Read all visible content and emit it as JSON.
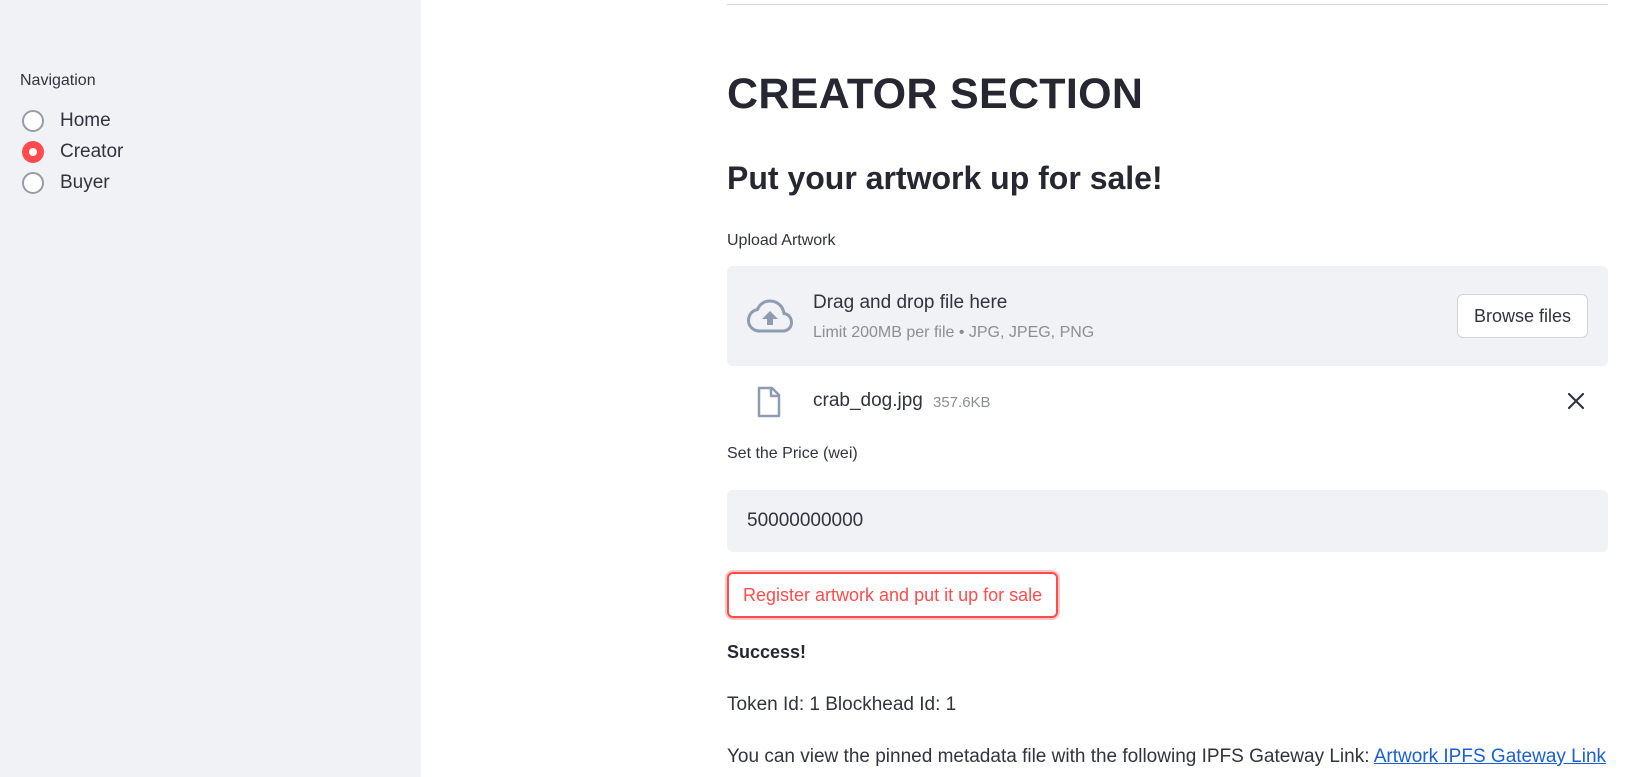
{
  "sidebar": {
    "label": "Navigation",
    "options": [
      {
        "label": "Home",
        "selected": false
      },
      {
        "label": "Creator",
        "selected": true
      },
      {
        "label": "Buyer",
        "selected": false
      }
    ]
  },
  "main": {
    "title": "CREATOR SECTION",
    "subtitle": "Put your artwork up for sale!",
    "upload": {
      "label": "Upload Artwork",
      "dropzone_title": "Drag and drop file here",
      "limit_text": "Limit 200MB per file • JPG, JPEG, PNG",
      "browse_label": "Browse files",
      "file_name": "crab_dog.jpg",
      "file_size": "357.6KB"
    },
    "price": {
      "label": "Set the Price (wei)",
      "value": "50000000000"
    },
    "register_label": "Register artwork and put it up for sale",
    "success_text": "Success!",
    "token_text": "Token Id: 1 Blockhead Id: 1",
    "ipfs_text": "You can view the pinned metadata file with the following IPFS Gateway Link: ",
    "ipfs_link": "Artwork IPFS Gateway Link"
  },
  "colors": {
    "accent": "#ff4b4b",
    "sidebar_bg": "#f0f2f6",
    "link": "#1a5fd6"
  },
  "icons": {
    "upload": "cloud-upload-icon",
    "file": "file-icon",
    "remove": "close-icon"
  }
}
